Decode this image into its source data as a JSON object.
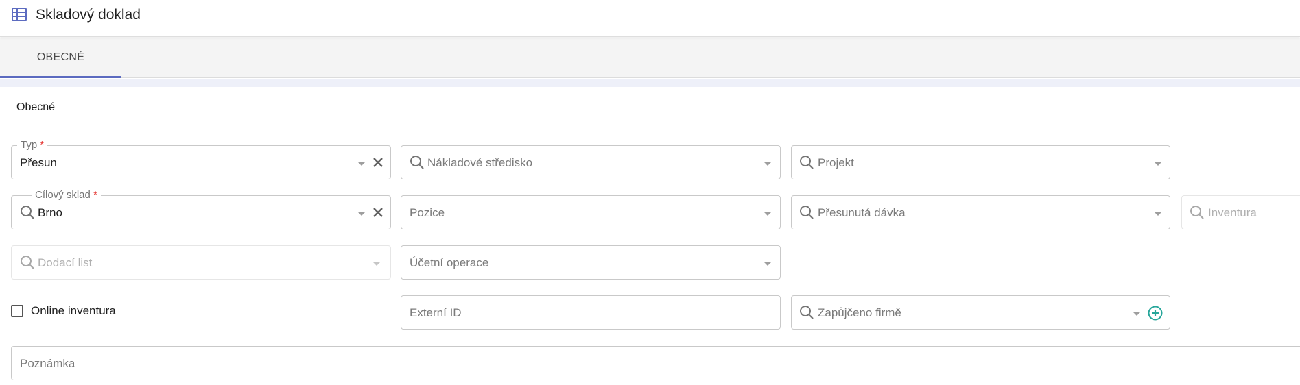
{
  "header": {
    "title": "Skladový doklad",
    "icon": "table-icon",
    "icon_color": "#5c6bc0"
  },
  "tabs": [
    {
      "label": "OBECNÉ",
      "active": true
    }
  ],
  "section": {
    "title": "Obecné"
  },
  "fields": {
    "typ": {
      "label": "Typ",
      "required_mark": "*",
      "value": "Přesun"
    },
    "nakladove_stredisko": {
      "placeholder": "Nákladové středisko"
    },
    "projekt": {
      "placeholder": "Projekt"
    },
    "cilovy_sklad": {
      "label": "Cílový sklad",
      "required_mark": "*",
      "value": "Brno"
    },
    "pozice": {
      "placeholder": "Pozice"
    },
    "presunuta_davka": {
      "placeholder": "Přesunutá dávka"
    },
    "inventura": {
      "placeholder": "Inventura"
    },
    "dodaci_list": {
      "placeholder": "Dodací list"
    },
    "ucetni_operace": {
      "placeholder": "Účetní operace"
    },
    "externi_id": {
      "placeholder": "Externí ID"
    },
    "zapujceno_firme": {
      "placeholder": "Zapůjčeno firmě"
    },
    "poznamka": {
      "placeholder": "Poznámka"
    }
  },
  "online_inventura": {
    "label": "Online inventura",
    "checked": false
  },
  "colors": {
    "accent": "#5c6bc0",
    "required": "#e53935",
    "add": "#26a69a"
  }
}
